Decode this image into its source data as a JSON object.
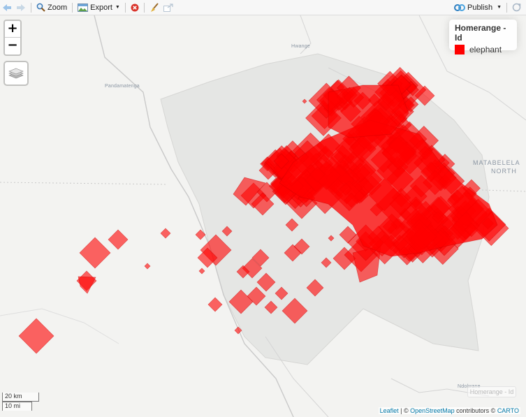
{
  "toolbar": {
    "zoom_label": "Zoom",
    "export_label": "Export",
    "publish_label": "Publish"
  },
  "map": {
    "places": {
      "hwange": "Hwange",
      "pandamatenga": "Pandamatenga",
      "ndolwane": "Ndolwane"
    },
    "region_line1": "MATABELELA",
    "region_line2": "NORTH",
    "zoom_in": "+",
    "zoom_out": "−",
    "fill_color": "#ff0000",
    "fill_opacity": 0.6
  },
  "legend": {
    "title": "Homerange - Id",
    "items": [
      {
        "label": "elephant",
        "color": "#ff0000"
      }
    ]
  },
  "scale": {
    "km": "20 km",
    "mi": "10 mi"
  },
  "faded_label": "Homerange - Id",
  "attribution": {
    "leaflet": "Leaflet",
    "sep": " | © ",
    "osm": "OpenStreetMap",
    "mid": " contributors © ",
    "carto": "CARTO"
  }
}
